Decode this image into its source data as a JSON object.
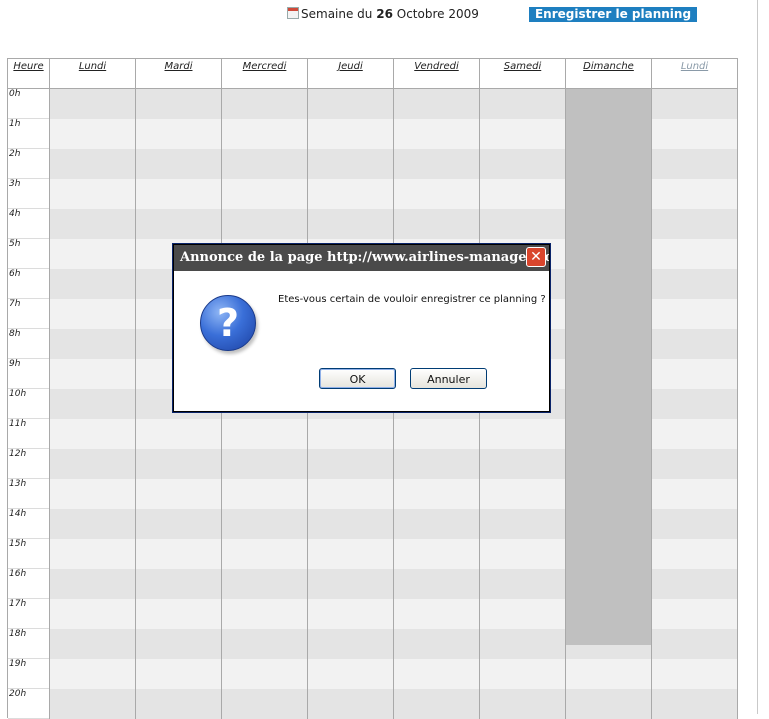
{
  "header": {
    "week_prefix": "Semaine du",
    "week_day": "26",
    "week_month_year": "Octobre 2009",
    "save_button": "Enregistrer le planning",
    "calendar_icon": "calendar-icon"
  },
  "grid": {
    "hour_header": "Heure",
    "days": [
      "Lundi",
      "Mardi",
      "Mercredi",
      "Jeudi",
      "Vendredi",
      "Samedi",
      "Dimanche",
      "Lundi"
    ],
    "hours": [
      "0h",
      "1h",
      "2h",
      "3h",
      "4h",
      "5h",
      "6h",
      "7h",
      "8h",
      "9h",
      "10h",
      "11h",
      "12h",
      "13h",
      "14h",
      "15h",
      "16h",
      "17h",
      "18h",
      "19h",
      "20h"
    ]
  },
  "dialog": {
    "title": "Annonce de la page http://www.airlines-manager.co...",
    "message": "Etes-vous certain de vouloir enregistrer ce planning ?",
    "ok_label": "OK",
    "cancel_label": "Annuler",
    "close_symbol": "✕",
    "icon_symbol": "?",
    "icon": "question-icon"
  }
}
